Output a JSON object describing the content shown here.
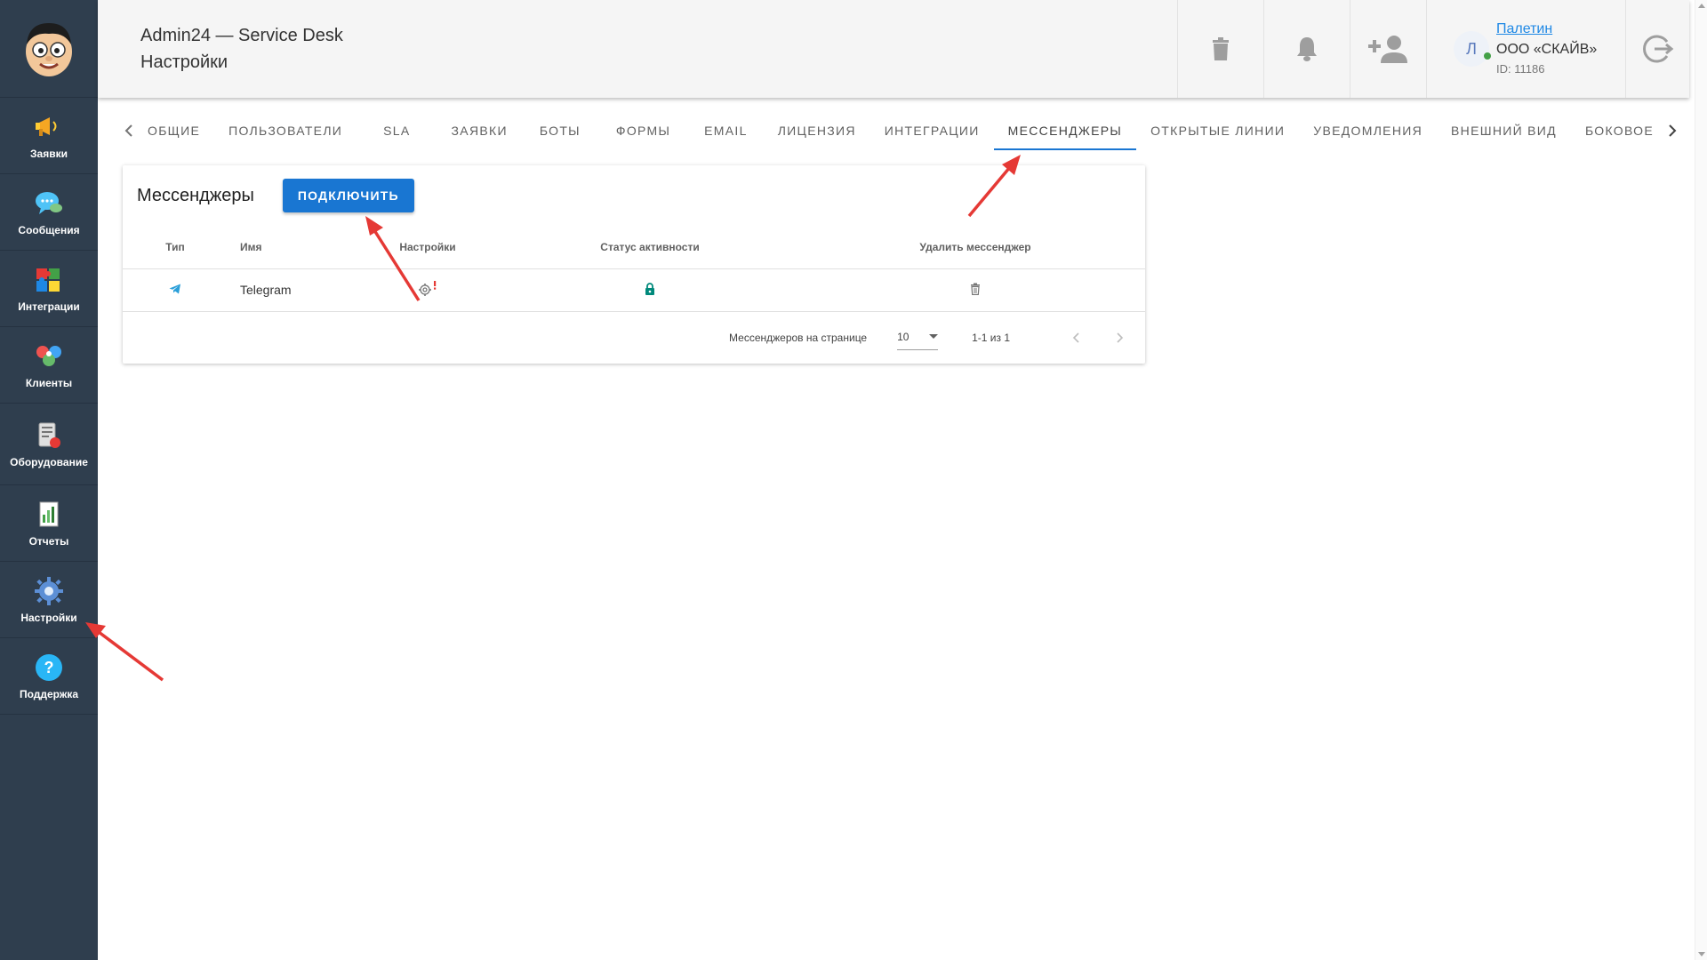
{
  "header": {
    "app_title": "Admin24 — Service Desk",
    "page_title": "Настройки",
    "user": {
      "avatar_letter": "Л",
      "name": "Палетин",
      "org": "ООО «СКАЙВ»",
      "id": "ID: 11186"
    },
    "icons": [
      "trash-icon",
      "bell-icon",
      "add-user-icon",
      "logout-icon"
    ]
  },
  "sidebar": {
    "items": [
      {
        "label": "Заявки",
        "icon": "megaphone-icon"
      },
      {
        "label": "Сообщения",
        "icon": "chat-icon"
      },
      {
        "label": "Интеграции",
        "icon": "puzzle-icon"
      },
      {
        "label": "Клиенты",
        "icon": "clients-icon"
      },
      {
        "label": "Оборудование",
        "icon": "equipment-icon"
      },
      {
        "label": "Отчеты",
        "icon": "report-icon"
      },
      {
        "label": "Настройки",
        "icon": "gear-icon"
      },
      {
        "label": "Поддержка",
        "icon": "help-icon"
      }
    ]
  },
  "tabs": {
    "items": [
      "ОБЩИЕ",
      "ПОЛЬЗОВАТЕЛИ",
      "SLA",
      "ЗАЯВКИ",
      "БОТЫ",
      "ФОРМЫ",
      "EMAIL",
      "ЛИЦЕНЗИЯ",
      "ИНТЕГРАЦИИ",
      "МЕССЕНДЖЕРЫ",
      "ОТКРЫТЫЕ ЛИНИИ",
      "УВЕДОМЛЕНИЯ",
      "ВНЕШНИЙ ВИД",
      "БОКОВОЕ"
    ],
    "active": "МЕССЕНДЖЕРЫ"
  },
  "card": {
    "title": "Мессенджеры",
    "connect_label": "ПОДКЛЮЧИТЬ",
    "columns": [
      "Тип",
      "Имя",
      "Настройки",
      "Статус активности",
      "Удалить мессенджер"
    ],
    "rows": [
      {
        "type_icon": "telegram-icon",
        "name": "Telegram",
        "settings_icon": "gear-warning-icon",
        "status_icon": "lock-icon",
        "delete_icon": "trash-icon"
      }
    ],
    "pager": {
      "label": "Мессенджеров на странице",
      "per_page": "10",
      "range": "1-1 из 1"
    }
  },
  "colors": {
    "sidebar_bg": "#2f3e4e",
    "accent": "#1976d2",
    "status_green": "#00897b",
    "annotation_red": "#e53935"
  }
}
